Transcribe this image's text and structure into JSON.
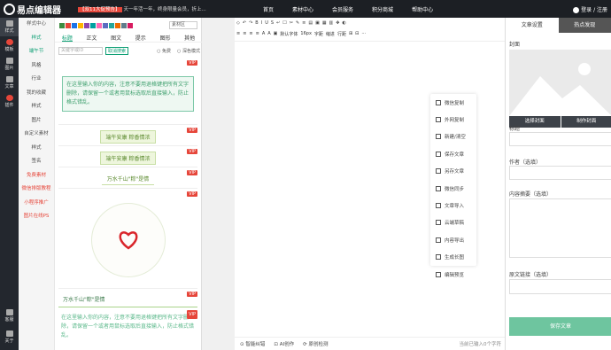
{
  "app": {
    "logo": "易点编辑器"
  },
  "promo": {
    "tag": "【双11大促预告】",
    "text": "天一年活一年，终身限量会员，折上..."
  },
  "nav": [
    "首页",
    "素材中心",
    "会员服务",
    "积分商城",
    "帮助中心"
  ],
  "login": "登录 / 注册",
  "rail": [
    {
      "label": "样式",
      "icon": "layers-icon"
    },
    {
      "label": "模板",
      "icon": "template-icon"
    },
    {
      "label": "图片",
      "icon": "image-icon"
    },
    {
      "label": "文章",
      "icon": "doc-icon"
    },
    {
      "label": "插件",
      "icon": "plugin-icon"
    }
  ],
  "rail_bottom": [
    {
      "label": "客服",
      "icon": "support-icon"
    },
    {
      "label": "关于",
      "icon": "info-icon"
    }
  ],
  "categories": [
    {
      "label": "样式中心",
      "cls": "hd"
    },
    {
      "label": "样式",
      "cls": "active"
    },
    {
      "label": "端午节",
      "cls": "active"
    },
    {
      "label": "风格",
      "cls": ""
    },
    {
      "label": "行业",
      "cls": ""
    },
    {
      "label": "我的收藏",
      "cls": "hd"
    },
    {
      "label": "样式",
      "cls": ""
    },
    {
      "label": "图片",
      "cls": ""
    },
    {
      "label": "自定义素材",
      "cls": "hd"
    },
    {
      "label": "样式",
      "cls": ""
    },
    {
      "label": "签名",
      "cls": ""
    },
    {
      "label": "免费素材",
      "cls": "red"
    },
    {
      "label": "微信排版教程",
      "cls": "red"
    },
    {
      "label": "小程序推广",
      "cls": "red"
    },
    {
      "label": "图片在线PS",
      "cls": "red"
    }
  ],
  "swatch_colors": [
    "#3d8c40",
    "#e6463a",
    "#1a73e8",
    "#ffb400",
    "#8e44ad",
    "#00a0a0",
    "#ff69b4",
    "#5c6bc0",
    "#26a69a",
    "#ef6c00",
    "#607d8b",
    "#d81b60"
  ],
  "swatch_select": "素材区",
  "tpl_tabs": [
    "标题",
    "正文",
    "图文",
    "提示",
    "图形",
    "其他"
  ],
  "search": {
    "placeholder": "关键字或ID",
    "button": "取消搜索",
    "opt_free": "免费",
    "opt_dark": "深色模式"
  },
  "templates": {
    "vip": "VIP",
    "t1_text": "在这里输入你的内容，注意不要用退格键把所有文字删除，请保留一个或者用鼠标选取后直接输入，防止格式错乱。",
    "t2_text": "端午安康 粽香情浓",
    "t3_text": "端午安康 粽香情浓",
    "t4_text": "万水千山\"粽\"是情",
    "t6_text": "万水千山\"粽\"是情",
    "t7_text": "在这里输入你的内容，注意不要用退格键把所有文字删除，请保留一个或者用鼠标选取后直接输入，防止格式错乱。"
  },
  "toolbar": {
    "row1": [
      "◇",
      "↶",
      "↷",
      "B",
      "I",
      "U",
      "S",
      "↵",
      "☐",
      "✂",
      "✎",
      "≡",
      "▤",
      "▣",
      "▦",
      "▥",
      "✥",
      "◐"
    ],
    "row2": [
      "≡",
      "≡",
      "≡",
      "≡",
      "A",
      "A",
      "▣",
      "默认字体",
      "16px",
      "字距",
      "缩进",
      "行距",
      "⊞",
      "⊟",
      "⋯"
    ]
  },
  "bottom": {
    "check": "智能纠错",
    "ai": "AI创作",
    "detect": "原创检测",
    "count": "当前已输入0个字符"
  },
  "float_menu": [
    "微信复制",
    "外网复制",
    "新建/清空",
    "保存文章",
    "另存文章",
    "微信同步",
    "文章导入",
    "云端草稿",
    "内容导出",
    "生成长图",
    "编辑预览"
  ],
  "right": {
    "tabs": [
      "文章设置",
      "热点发现"
    ],
    "cover_label": "封面",
    "cover_buttons": [
      "选择封面",
      "制作封面"
    ],
    "title_label": "标题",
    "author_label": "作者（选填）",
    "summary_label": "内容摘要（选填）",
    "link_label": "原文链接（选填）",
    "save": "保存文章"
  }
}
